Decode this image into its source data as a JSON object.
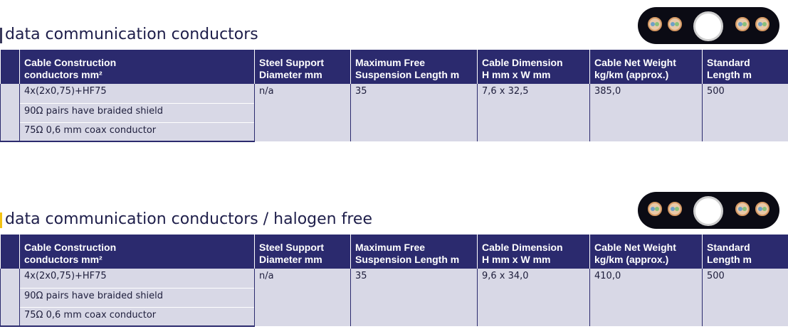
{
  "tables": [
    {
      "title": "data communication conductors",
      "headers": {
        "construction_1": "Cable Construction",
        "construction_2": "conductors mm²",
        "steel_1": "Steel Support",
        "steel_2": "Diameter mm",
        "suspension_1": "Maximum Free",
        "suspension_2": "Suspension Length m",
        "dimension_1": "Cable Dimension",
        "dimension_2": "H mm x W mm",
        "weight_1": "Cable Net Weight",
        "weight_2": "kg/km (approx.)",
        "length_1": "Standard",
        "length_2": "Length m"
      },
      "row": {
        "construction": "4x(2x0,75)+HF75",
        "construction_note1": "90Ω pairs have braided shield",
        "construction_note2": "75Ω 0,6 mm coax conductor",
        "steel": "n/a",
        "suspension": "35",
        "dimension": "7,6 x 32,5",
        "weight": "385,0",
        "length": "500"
      }
    },
    {
      "title": "data communication conductors / halogen free",
      "headers": {
        "construction_1": "Cable Construction",
        "construction_2": "conductors mm²",
        "steel_1": "Steel Support",
        "steel_2": "Diameter mm",
        "suspension_1": "Maximum Free",
        "suspension_2": "Suspension Length m",
        "dimension_1": "Cable Dimension",
        "dimension_2": "H mm x W mm",
        "weight_1": "Cable Net Weight",
        "weight_2": "kg/km (approx.)",
        "length_1": "Standard",
        "length_2": "Length m"
      },
      "row": {
        "construction": "4x(2x0,75)+HF75",
        "construction_note1": "90Ω pairs have braided shield",
        "construction_note2": "75Ω 0,6 mm coax conductor",
        "steel": "n/a",
        "suspension": "35",
        "dimension": "9,6 x 34,0",
        "weight": "410,0",
        "length": "500"
      }
    }
  ],
  "colors": {
    "header_bg": "#2b2a6e",
    "row_bg": "#d8d8e6",
    "accent": "#f3c212"
  },
  "icons": [
    "flat-cable-cross-section-icon"
  ]
}
